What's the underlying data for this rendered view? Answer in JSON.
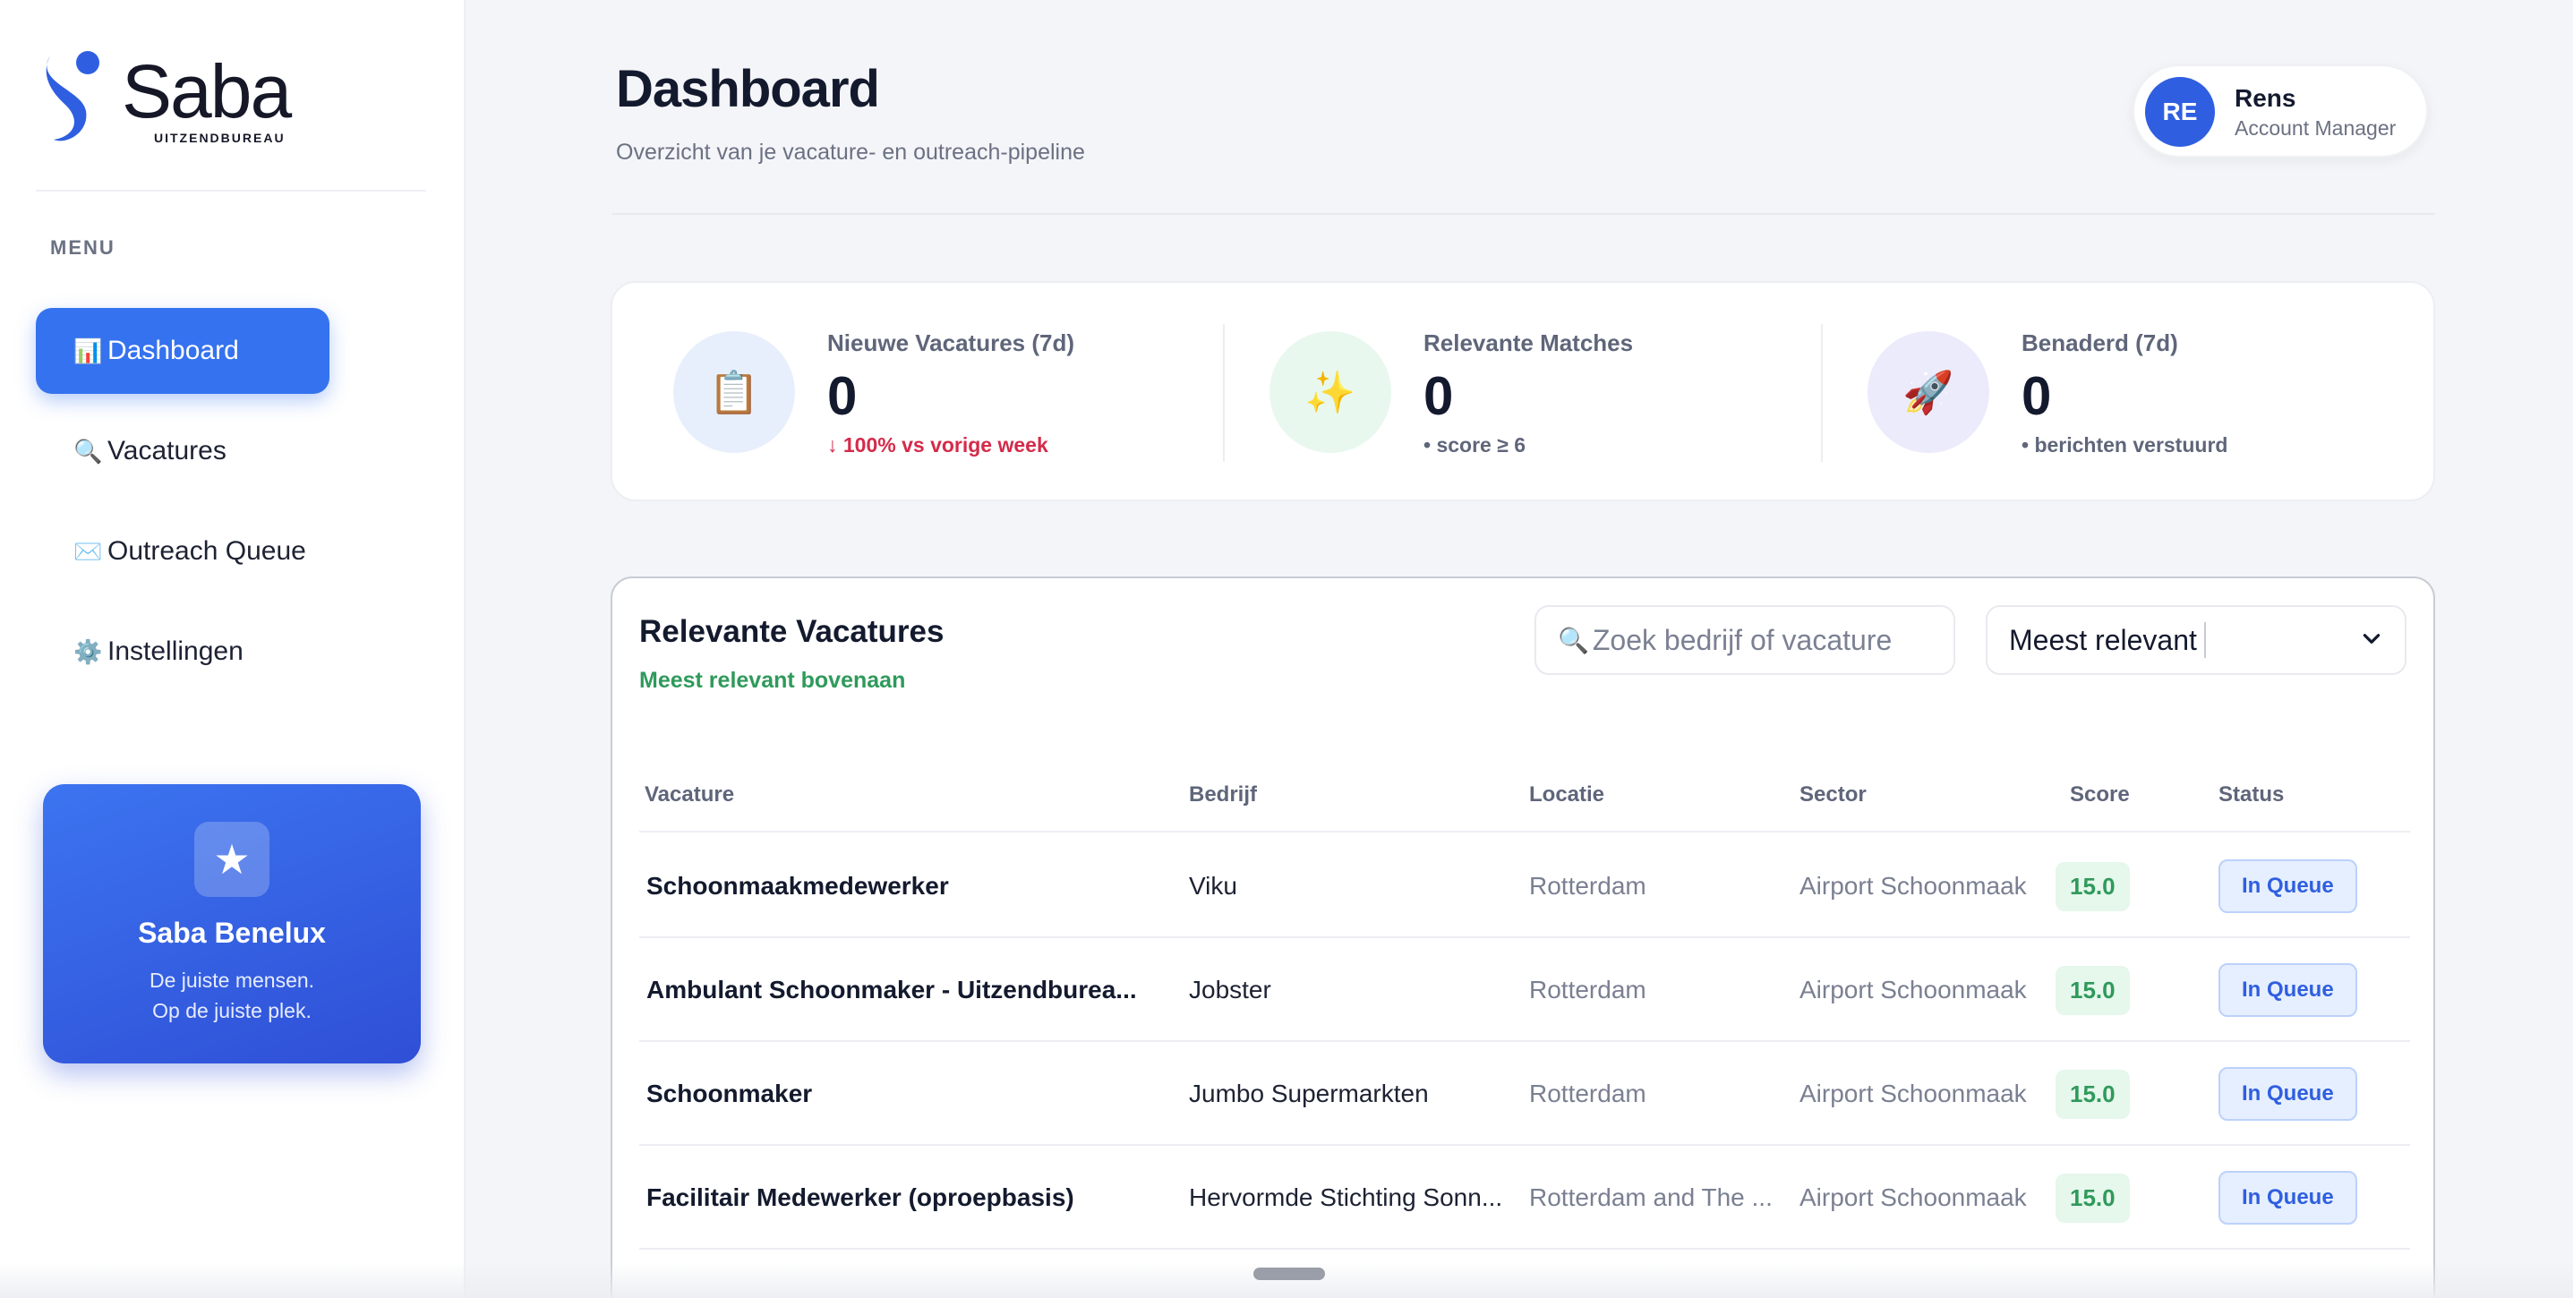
{
  "brand": {
    "name": "Saba",
    "sub": "UITZENDBUREAU",
    "accent": "#3572ef"
  },
  "sidebar": {
    "menu_heading": "MENU",
    "items": [
      {
        "icon": "📊",
        "icon_name": "chart-icon",
        "label": "Dashboard",
        "active": true
      },
      {
        "icon": "🔍",
        "icon_name": "search-icon",
        "label": "Vacatures",
        "active": false
      },
      {
        "icon": "✉️",
        "icon_name": "envelope-icon",
        "label": "Outreach Queue",
        "active": false
      },
      {
        "icon": "⚙️",
        "icon_name": "gear-icon",
        "label": "Instellingen",
        "active": false
      }
    ],
    "promo": {
      "icon": "★",
      "title": "Saba Benelux",
      "line1": "De juiste mensen.",
      "line2": "Op de juiste plek."
    }
  },
  "header": {
    "title": "Dashboard",
    "subtitle": "Overzicht van je vacature- en outreach-pipeline",
    "user": {
      "initials": "RE",
      "name": "Rens",
      "role": "Account Manager"
    }
  },
  "stats": [
    {
      "icon": "📋",
      "icon_name": "clipboard-icon",
      "label": "Nieuwe Vacatures (7d)",
      "value": "0",
      "note": "↓ 100% vs vorige week",
      "note_color": "#d42b4a",
      "circle_color": "#e8effc"
    },
    {
      "icon": "✨",
      "icon_name": "sparkles-icon",
      "label": "Relevante Matches",
      "value": "0",
      "note": "• score ≥ 6",
      "note_color": "#5f667a",
      "circle_color": "#e8f8ee"
    },
    {
      "icon": "🚀",
      "icon_name": "rocket-icon",
      "label": "Benaderd (7d)",
      "value": "0",
      "note": "• berichten verstuurd",
      "note_color": "#5f667a",
      "circle_color": "#ecebfb"
    }
  ],
  "vacancies": {
    "title": "Relevante Vacatures",
    "subtitle": "Meest relevant bovenaan",
    "search_placeholder": "Zoek bedrijf of vacature",
    "sort_value": "Meest relevant",
    "columns": [
      "Vacature",
      "Bedrijf",
      "Locatie",
      "Sector",
      "Score",
      "Status"
    ],
    "rows": [
      {
        "title": "Schoonmaakmedewerker",
        "company": "Viku",
        "location": "Rotterdam",
        "sector": "Airport Schoonmaak",
        "score": "15.0",
        "status": "In Queue"
      },
      {
        "title": "Ambulant Schoonmaker - Uitzendburea...",
        "company": "Jobster",
        "location": "Rotterdam",
        "sector": "Airport Schoonmaak",
        "score": "15.0",
        "status": "In Queue"
      },
      {
        "title": "Schoonmaker",
        "company": "Jumbo Supermarkten",
        "location": "Rotterdam",
        "sector": "Airport Schoonmaak",
        "score": "15.0",
        "status": "In Queue"
      },
      {
        "title": "Facilitair Medewerker (oproepbasis)",
        "company": "Hervormde Stichting Sonn...",
        "location": "Rotterdam and The ...",
        "sector": "Airport Schoonmaak",
        "score": "15.0",
        "status": "In Queue"
      }
    ]
  }
}
